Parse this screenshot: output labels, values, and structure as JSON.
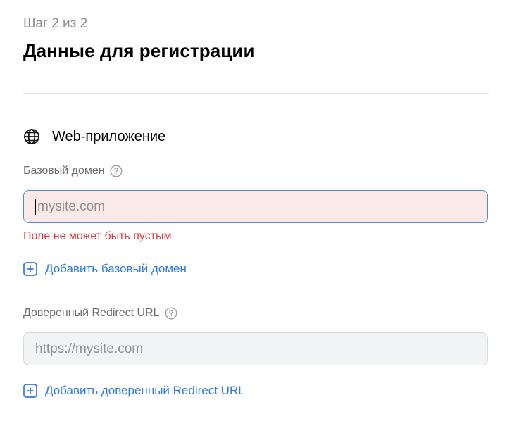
{
  "header": {
    "step": "Шаг 2 из 2",
    "title": "Данные для регистрации"
  },
  "section": {
    "icon": "globe-icon",
    "title": "Web-приложение"
  },
  "base_domain": {
    "label": "Базовый домен",
    "help_icon": "help-circle-icon",
    "placeholder": "mysite.com",
    "value": "",
    "error": "Поле не может быть пустым",
    "add_label": "Добавить базовый домен"
  },
  "redirect": {
    "label": "Доверенный Redirect URL",
    "help_icon": "help-circle-icon",
    "placeholder": "https://mysite.com",
    "value": "",
    "add_label": "Добавить доверенный Redirect URL"
  },
  "colors": {
    "accent": "#2d7be0",
    "error": "#e0383a",
    "error_bg": "#fbe9e8",
    "input_bg": "#f2f3f5",
    "muted": "#8c8c8c"
  }
}
